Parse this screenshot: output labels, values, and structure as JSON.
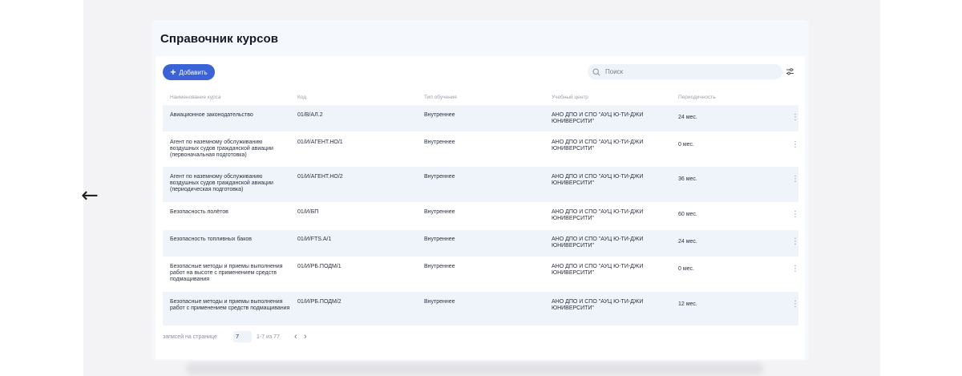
{
  "nav": {
    "back_symbol": "←"
  },
  "page": {
    "title": "Справочник курсов"
  },
  "toolbar": {
    "add_label": "Добавить",
    "add_icon": "+",
    "search_placeholder": "Поиск"
  },
  "table": {
    "columns": [
      "Наименование курса",
      "Код",
      "Тип обучения",
      "Учебный центр",
      "Периодичность"
    ],
    "rows": [
      {
        "name": "Авиационное законодательство",
        "code": "01/В/АЛ.2",
        "type": "Внутреннее",
        "center": "АНО ДПО И СПО \"АУЦ Ю-ТИ-ДЖИ ЮНИВЕРСИТИ\"",
        "period": "24 мес."
      },
      {
        "name": "Агент по наземному обслуживанию воздушных судов гражданской авиации (первоначальная подготовка)",
        "code": "01/И/АГЕНТ.НО/1",
        "type": "Внутреннее",
        "center": "АНО ДПО И СПО \"АУЦ Ю-ТИ-ДЖИ ЮНИВЕРСИТИ\"",
        "period": "0 мес."
      },
      {
        "name": "Агент по наземному обслуживанию воздушных судов гражданской авиации (периодическая подготовка)",
        "code": "01/И/АГЕНТ.НО/2",
        "type": "Внутреннее",
        "center": "АНО ДПО И СПО \"АУЦ Ю-ТИ-ДЖИ ЮНИВЕРСИТИ\"",
        "period": "36 мес."
      },
      {
        "name": "Безопасность полётов",
        "code": "01/И/БП",
        "type": "Внутреннее",
        "center": "АНО ДПО И СПО \"АУЦ Ю-ТИ-ДЖИ ЮНИВЕРСИТИ\"",
        "period": "60 мес."
      },
      {
        "name": "Безопасность топливных баков",
        "code": "01/И/FTS.А/1",
        "type": "Внутреннее",
        "center": "АНО ДПО И СПО \"АУЦ Ю-ТИ-ДЖИ ЮНИВЕРСИТИ\"",
        "period": "24 мес."
      },
      {
        "name": "Безопасные методы и приемы выполнения работ на высоте с применением средств подмащивания",
        "code": "01/И/РБ.ПОДМ/1",
        "type": "Внутреннее",
        "center": "АНО ДПО И СПО \"АУЦ Ю-ТИ-ДЖИ ЮНИВЕРСИТИ\"",
        "period": "0 мес."
      },
      {
        "name": "Безопасные методы и приемы выполнения работ с применением средств подмащивания",
        "code": "01/И/РБ.ПОДМ/2",
        "type": "Внутреннее",
        "center": "АНО ДПО И СПО \"АУЦ Ю-ТИ-ДЖИ ЮНИВЕРСИТИ\"",
        "period": "12 мес."
      }
    ],
    "row_menu_symbol": "⋮"
  },
  "pagination": {
    "per_page_label": "записей на странице",
    "per_page_value": "7",
    "range": "1-7 из 77",
    "prev_symbol": "‹",
    "next_symbol": "›"
  },
  "colors": {
    "accent": "#3b62d6",
    "row_shade": "#eff4fb",
    "panel": "#f5f8fd"
  }
}
